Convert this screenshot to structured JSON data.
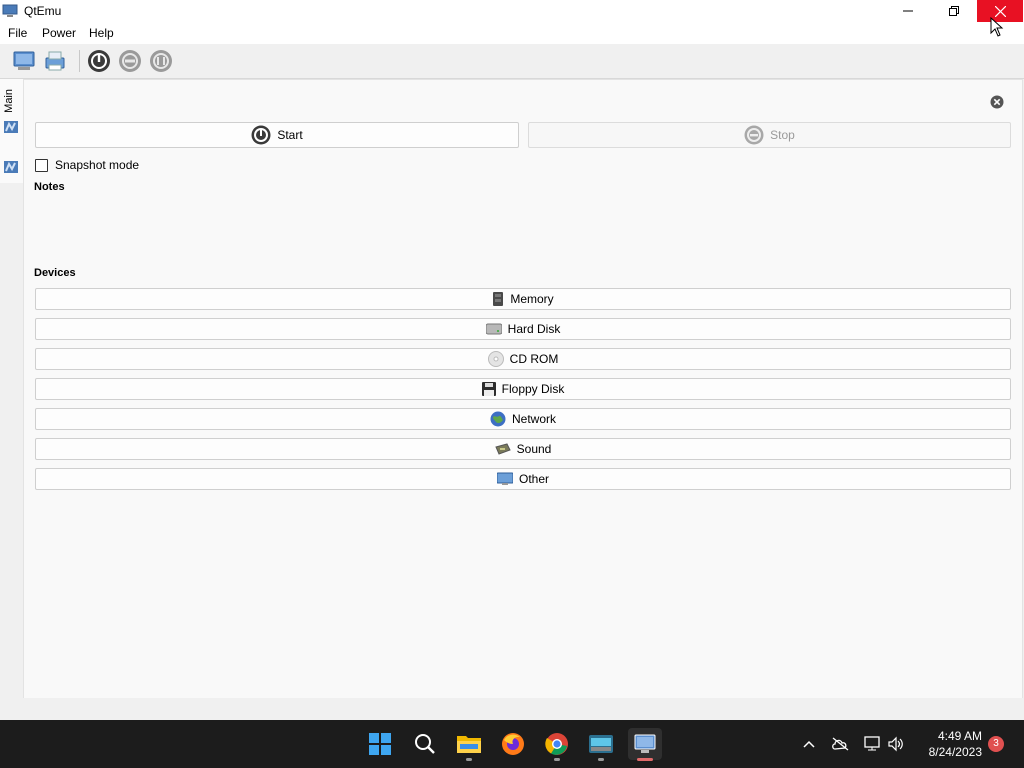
{
  "window": {
    "title": "QtEmu"
  },
  "menu": {
    "file": "File",
    "power": "Power",
    "help": "Help"
  },
  "toolbar": {
    "icons": [
      "computer-icon",
      "printer-icon",
      "power-icon",
      "pause-icon",
      "reset-icon"
    ]
  },
  "left_tabs": {
    "main_label": "Main"
  },
  "main": {
    "start_label": "Start",
    "stop_label": "Stop",
    "snapshot_label": "Snapshot mode",
    "snapshot_checked": false,
    "notes_label": "Notes",
    "devices_label": "Devices",
    "devices": [
      {
        "label": "Memory",
        "icon": "memory-icon"
      },
      {
        "label": "Hard Disk",
        "icon": "hard-disk-icon"
      },
      {
        "label": "CD ROM",
        "icon": "cd-rom-icon"
      },
      {
        "label": "Floppy Disk",
        "icon": "floppy-icon"
      },
      {
        "label": "Network",
        "icon": "globe-icon"
      },
      {
        "label": "Sound",
        "icon": "sound-card-icon"
      },
      {
        "label": "Other",
        "icon": "monitor-icon"
      }
    ]
  },
  "taskbar": {
    "time": "4:49 AM",
    "date": "8/24/2023",
    "notification_count": "3",
    "apps": [
      "windows-start-icon",
      "search-icon",
      "file-explorer-icon",
      "firefox-icon",
      "chrome-icon",
      "terminal-icon",
      "qtemu-taskbar-icon"
    ]
  },
  "colors": {
    "close_hover": "#e81123",
    "taskbar_bg": "#1c1c1c",
    "notification": "#e05050"
  }
}
